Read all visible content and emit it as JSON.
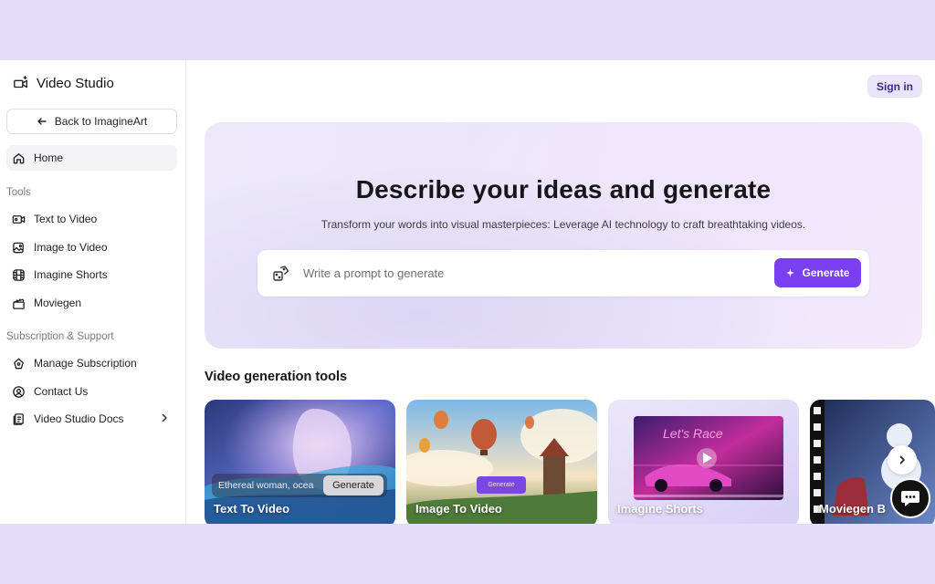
{
  "sidebar": {
    "brand_title": "Video Studio",
    "back_label": "Back to ImagineArt",
    "home_label": "Home",
    "tools_heading": "Tools",
    "tools": [
      {
        "label": "Text to Video",
        "icon": "video-camera-icon"
      },
      {
        "label": "Image to Video",
        "icon": "image-sparkle-icon"
      },
      {
        "label": "Imagine Shorts",
        "icon": "film-reel-icon"
      },
      {
        "label": "Moviegen",
        "icon": "clapperboard-icon"
      }
    ],
    "support_heading": "Subscription & Support",
    "support": [
      {
        "label": "Manage Subscription",
        "icon": "subscription-icon"
      },
      {
        "label": "Contact Us",
        "icon": "contact-icon"
      },
      {
        "label": "Video Studio Docs",
        "icon": "docs-icon"
      }
    ]
  },
  "header": {
    "signin_label": "Sign in"
  },
  "hero": {
    "title": "Describe your ideas and generate",
    "subtitle": "Transform your words into visual masterpieces: Leverage AI technology to craft breathtaking videos.",
    "prompt_placeholder": "Write a prompt to generate",
    "generate_label": "Generate"
  },
  "tools_section": {
    "title": "Video generation tools",
    "cards": [
      {
        "label": "Text To Video",
        "mini_prompt": "Ethereal woman, ocea",
        "mini_button": "Generate"
      },
      {
        "label": "Image To Video",
        "mini_button": "Generate"
      },
      {
        "label": "Imagine Shorts",
        "poster_text": "Let's Race"
      },
      {
        "label": "Moviegen B"
      }
    ]
  },
  "colors": {
    "accent": "#7b3ff2",
    "page_bg": "#e4dcfb",
    "signin_bg": "#e9e4f7"
  }
}
